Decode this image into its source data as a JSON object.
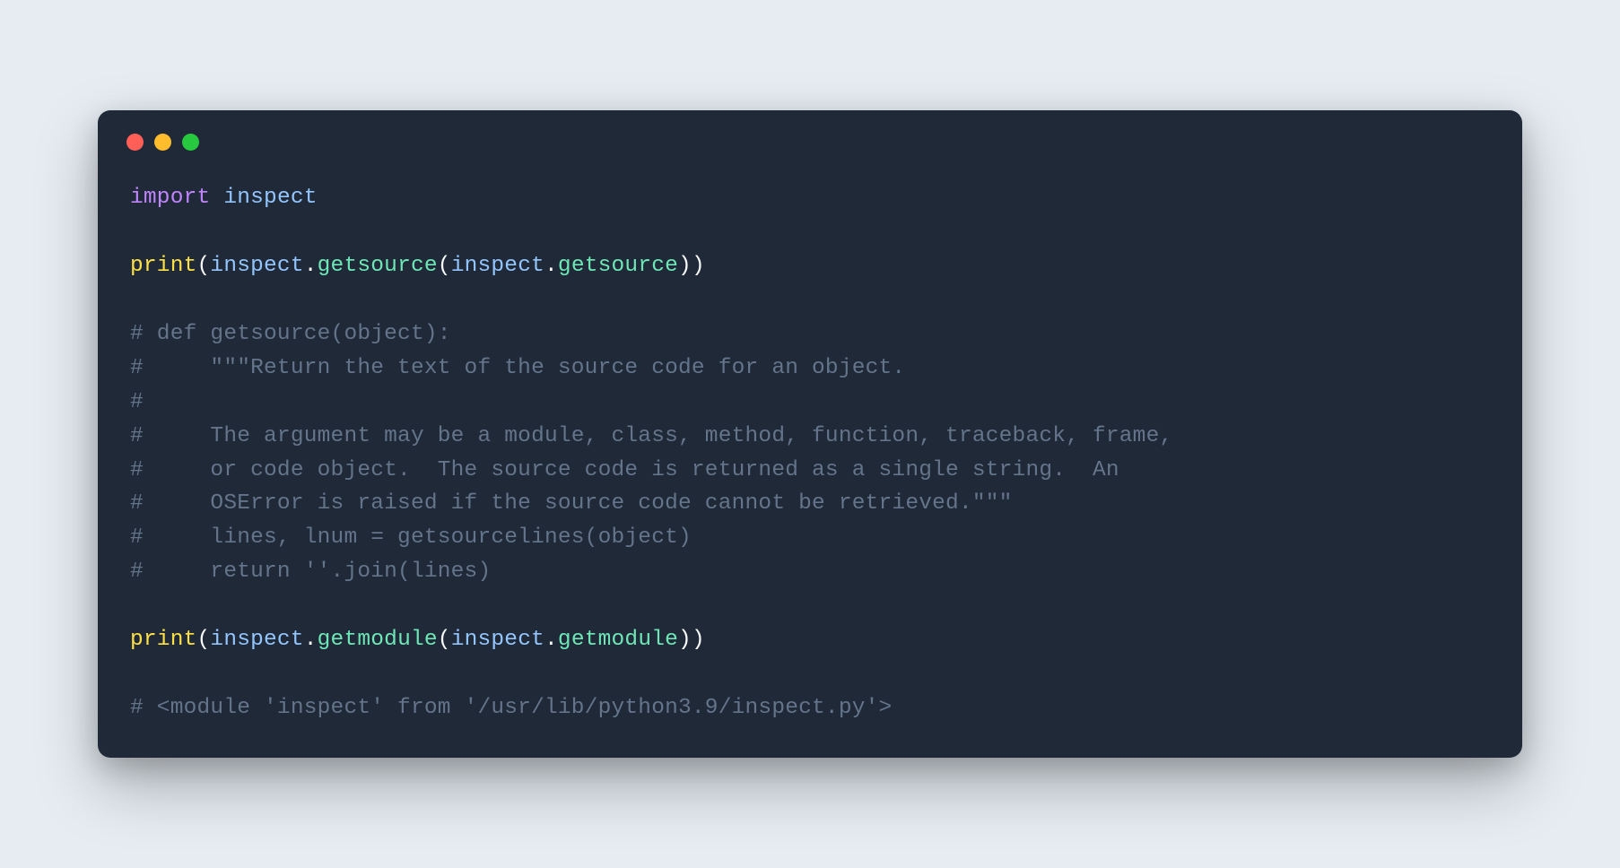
{
  "code": {
    "line1": {
      "import": "import",
      "module": "inspect"
    },
    "line3": {
      "func": "print",
      "lp1": "(",
      "obj1": "inspect",
      "dot1": ".",
      "meth1": "getsource",
      "lp2": "(",
      "obj2": "inspect",
      "dot2": ".",
      "meth2": "getsource",
      "rp2": ")",
      "rp1": ")"
    },
    "comment1": "# def getsource(object):",
    "comment2": "#     \"\"\"Return the text of the source code for an object.",
    "comment3": "#",
    "comment4": "#     The argument may be a module, class, method, function, traceback, frame,",
    "comment5": "#     or code object.  The source code is returned as a single string.  An",
    "comment6": "#     OSError is raised if the source code cannot be retrieved.\"\"\"",
    "comment7": "#     lines, lnum = getsourcelines(object)",
    "comment8": "#     return ''.join(lines)",
    "line13": {
      "func": "print",
      "lp1": "(",
      "obj1": "inspect",
      "dot1": ".",
      "meth1": "getmodule",
      "lp2": "(",
      "obj2": "inspect",
      "dot2": ".",
      "meth2": "getmodule",
      "rp2": ")",
      "rp1": ")"
    },
    "comment9": "# <module 'inspect' from '/usr/lib/python3.9/inspect.py'>"
  }
}
